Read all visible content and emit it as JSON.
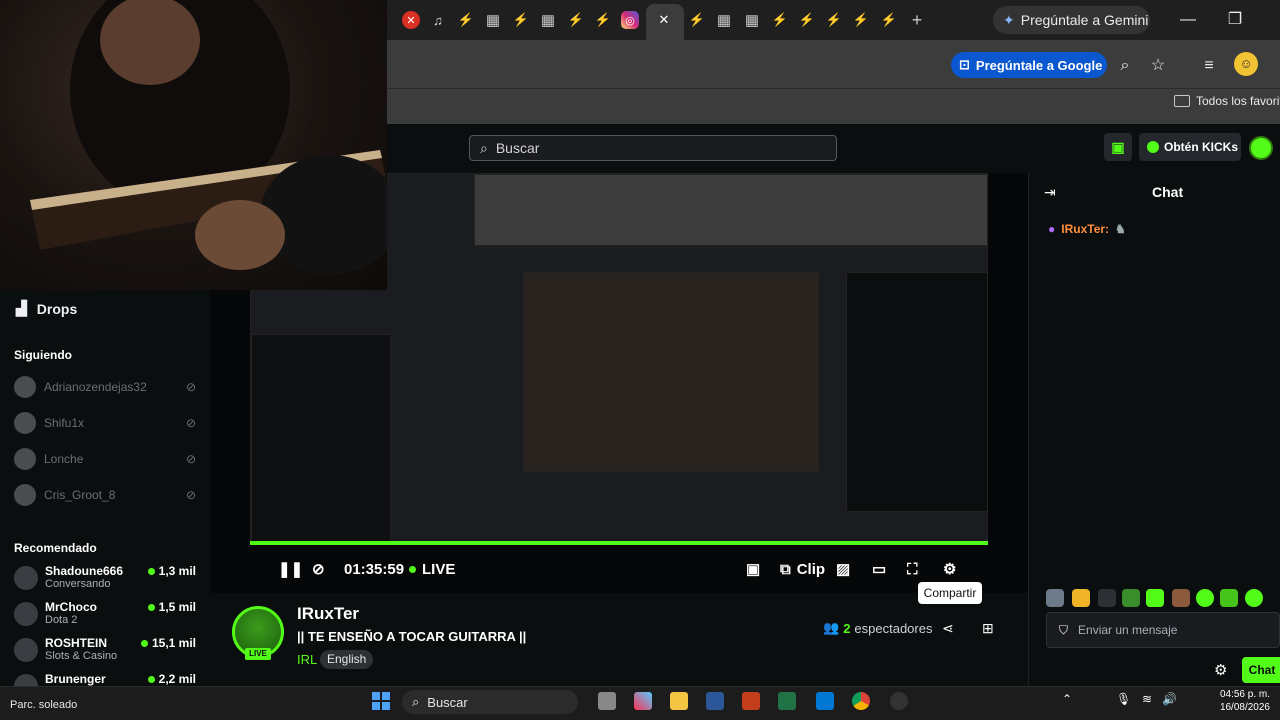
{
  "browser": {
    "gemini_label": "Pregúntale a Gemini",
    "ask_google_label": "Pregúntale a Google",
    "bookmarks_label": "Todos los favoritos"
  },
  "header": {
    "search_placeholder": "Buscar",
    "kicks_label": "Obtén KICKs"
  },
  "sidebar": {
    "drops_label": "Drops",
    "following_title": "Siguiendo",
    "following": [
      {
        "name": "Adrianozendejas32"
      },
      {
        "name": "Shifu1x"
      },
      {
        "name": "Lonche"
      },
      {
        "name": "Cris_Groot_8"
      }
    ],
    "recommended_title": "Recomendado",
    "recommended": [
      {
        "name": "Shadoune666",
        "category": "Conversando",
        "viewers": "1,3 mil"
      },
      {
        "name": "MrChoco",
        "category": "Dota 2",
        "viewers": "1,5 mil"
      },
      {
        "name": "ROSHTEIN",
        "category": "Slots & Casino",
        "viewers": "15,1 mil"
      },
      {
        "name": "Brunenger",
        "category": "",
        "viewers": "2,2 mil"
      }
    ]
  },
  "player": {
    "time": "01:35:59",
    "live_label": "LIVE",
    "clip_label": "Clip",
    "share_tooltip": "Compartir"
  },
  "stream": {
    "streamer": "IRuxTer",
    "live_badge": "LIVE",
    "title": "|| TE ENSEÑO A TOCAR GUITARRA ||",
    "category": "IRL",
    "language": "English",
    "viewer_count": "2",
    "viewer_label": "espectadores"
  },
  "chat": {
    "title": "Chat",
    "message_user": "IRuxTer:",
    "input_placeholder": "Enviar un mensaje",
    "send_label": "Chat"
  },
  "taskbar": {
    "weather": "Parc. soleado",
    "search_label": "Buscar",
    "time": "04:56 p. m.",
    "date": "16/08/2026"
  },
  "colors": {
    "kick_green": "#53fc18",
    "background": "#0b0e0f",
    "chrome_toolbar": "#3c3c3c"
  }
}
